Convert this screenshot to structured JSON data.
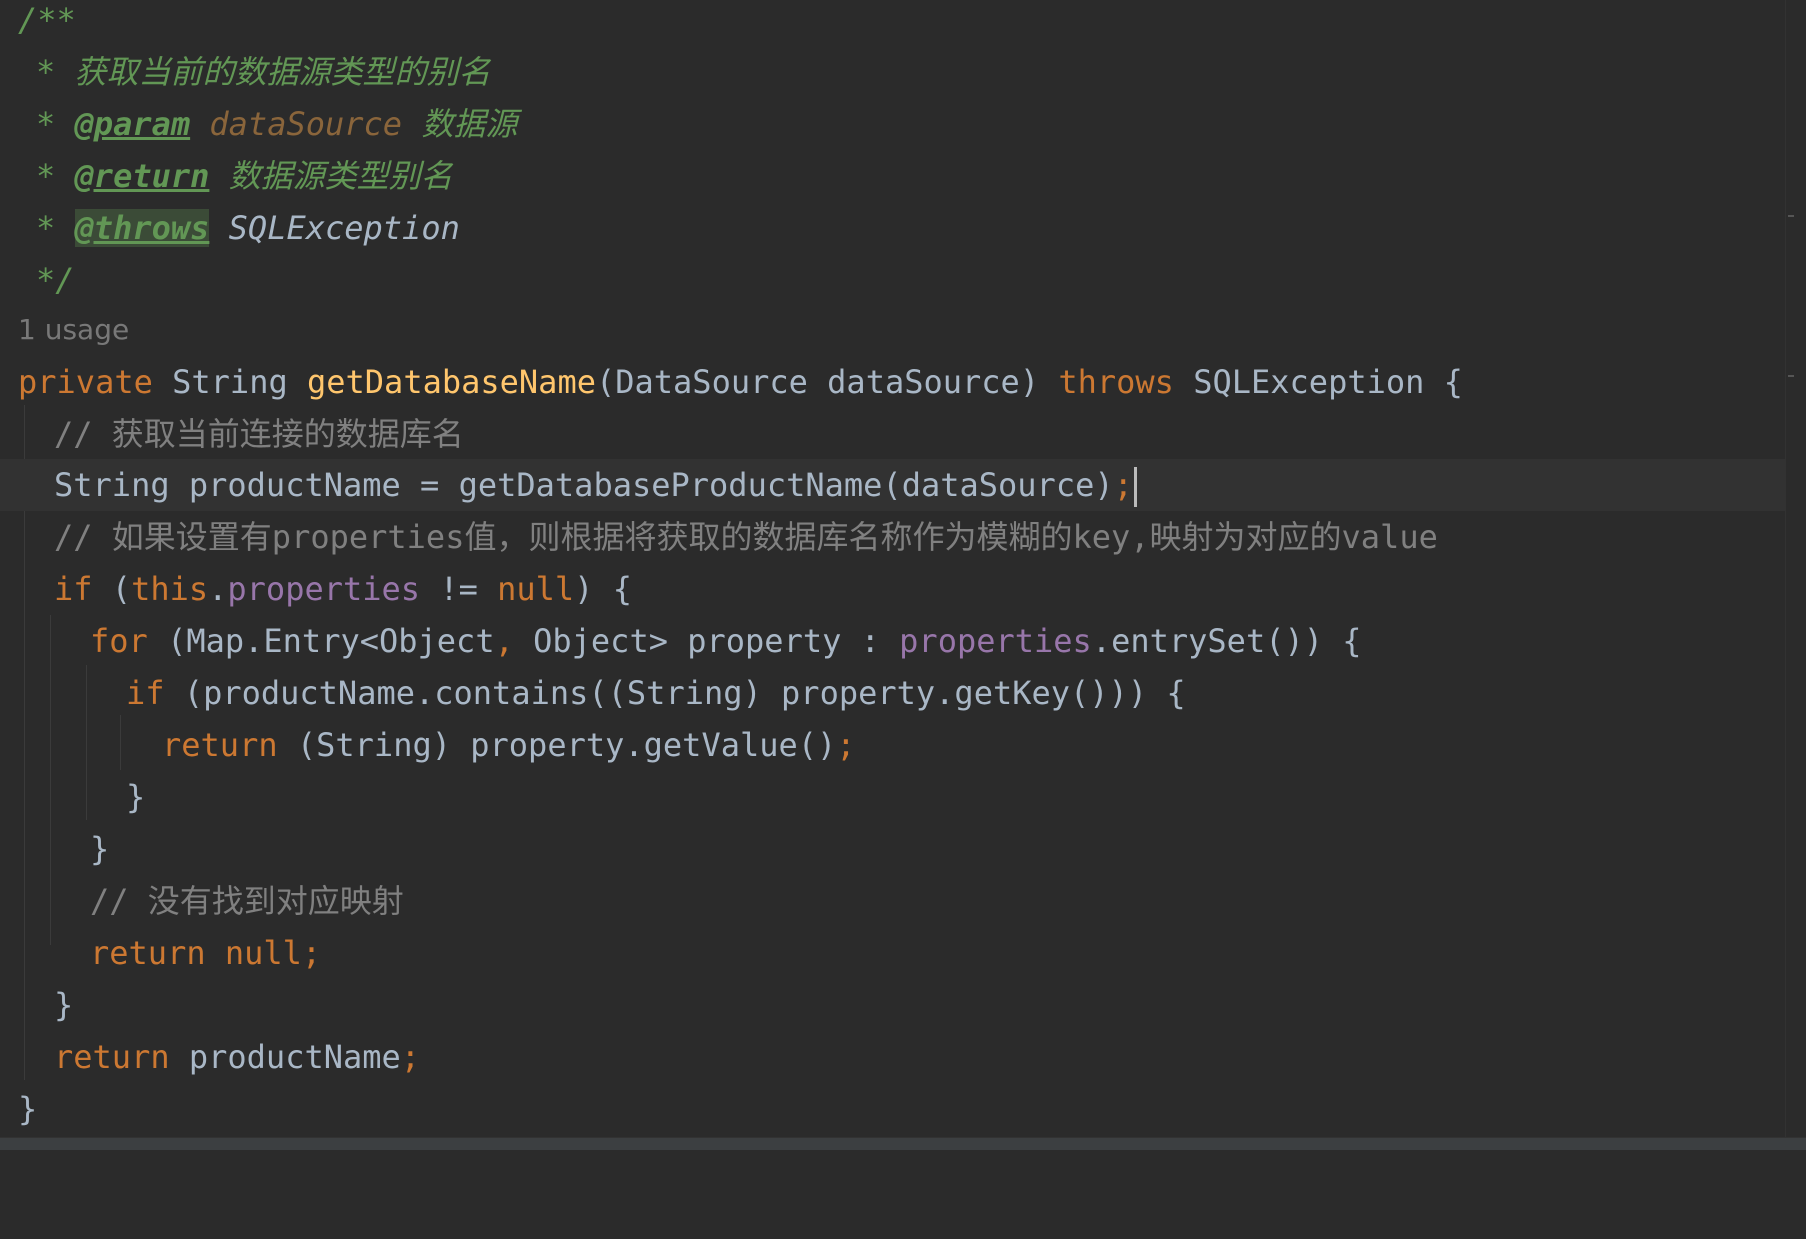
{
  "editor": {
    "doc": {
      "open": "/**",
      "star": "*",
      "desc": "获取当前的数据源类型的别名",
      "param_tag": "@param",
      "param_name": "dataSource",
      "param_desc": "数据源",
      "return_tag": "@return",
      "return_desc": "数据源类型别名",
      "throws_tag": "@throws",
      "throws_type": "SQLException",
      "close": "*/"
    },
    "usage": "1 usage",
    "sig": {
      "private": "private",
      "type": "String",
      "name": "getDatabaseName",
      "params": "(DataSource dataSource)",
      "throws": "throws",
      "exc": "SQLException {"
    },
    "c1": "// 获取当前连接的数据库名",
    "l_prod": {
      "pre": "String productName = ",
      "fn": "getDatabaseProductName",
      "args": "(dataSource)",
      "semi": ";"
    },
    "c2": "// 如果设置有properties值，则根据将获取的数据库名称作为模糊的key,映射为对应的value",
    "l_if1": {
      "kw": "if",
      "open": " (",
      "this": "this",
      "dot": ".",
      "field": "properties",
      "rest": " != ",
      "null": "null",
      "close": ") {"
    },
    "l_for": {
      "kw": "for",
      "a": " (Map.Entry<Object",
      "comma": ",",
      "b": " Object> property : ",
      "field": "properties",
      "c": ".entrySet()) {"
    },
    "l_if2": {
      "kw": "if",
      "rest": " (productName.contains((String) property.getKey())) {"
    },
    "l_ret1": {
      "kw": "return",
      "rest": " (String) property.getValue()",
      "semi": ";"
    },
    "brace": "}",
    "c3": "// 没有找到对应映射",
    "l_ret2": {
      "kw": "return null",
      "semi": ";"
    },
    "l_ret3": {
      "kw": "return",
      "rest": " productName",
      "semi": ";"
    }
  }
}
